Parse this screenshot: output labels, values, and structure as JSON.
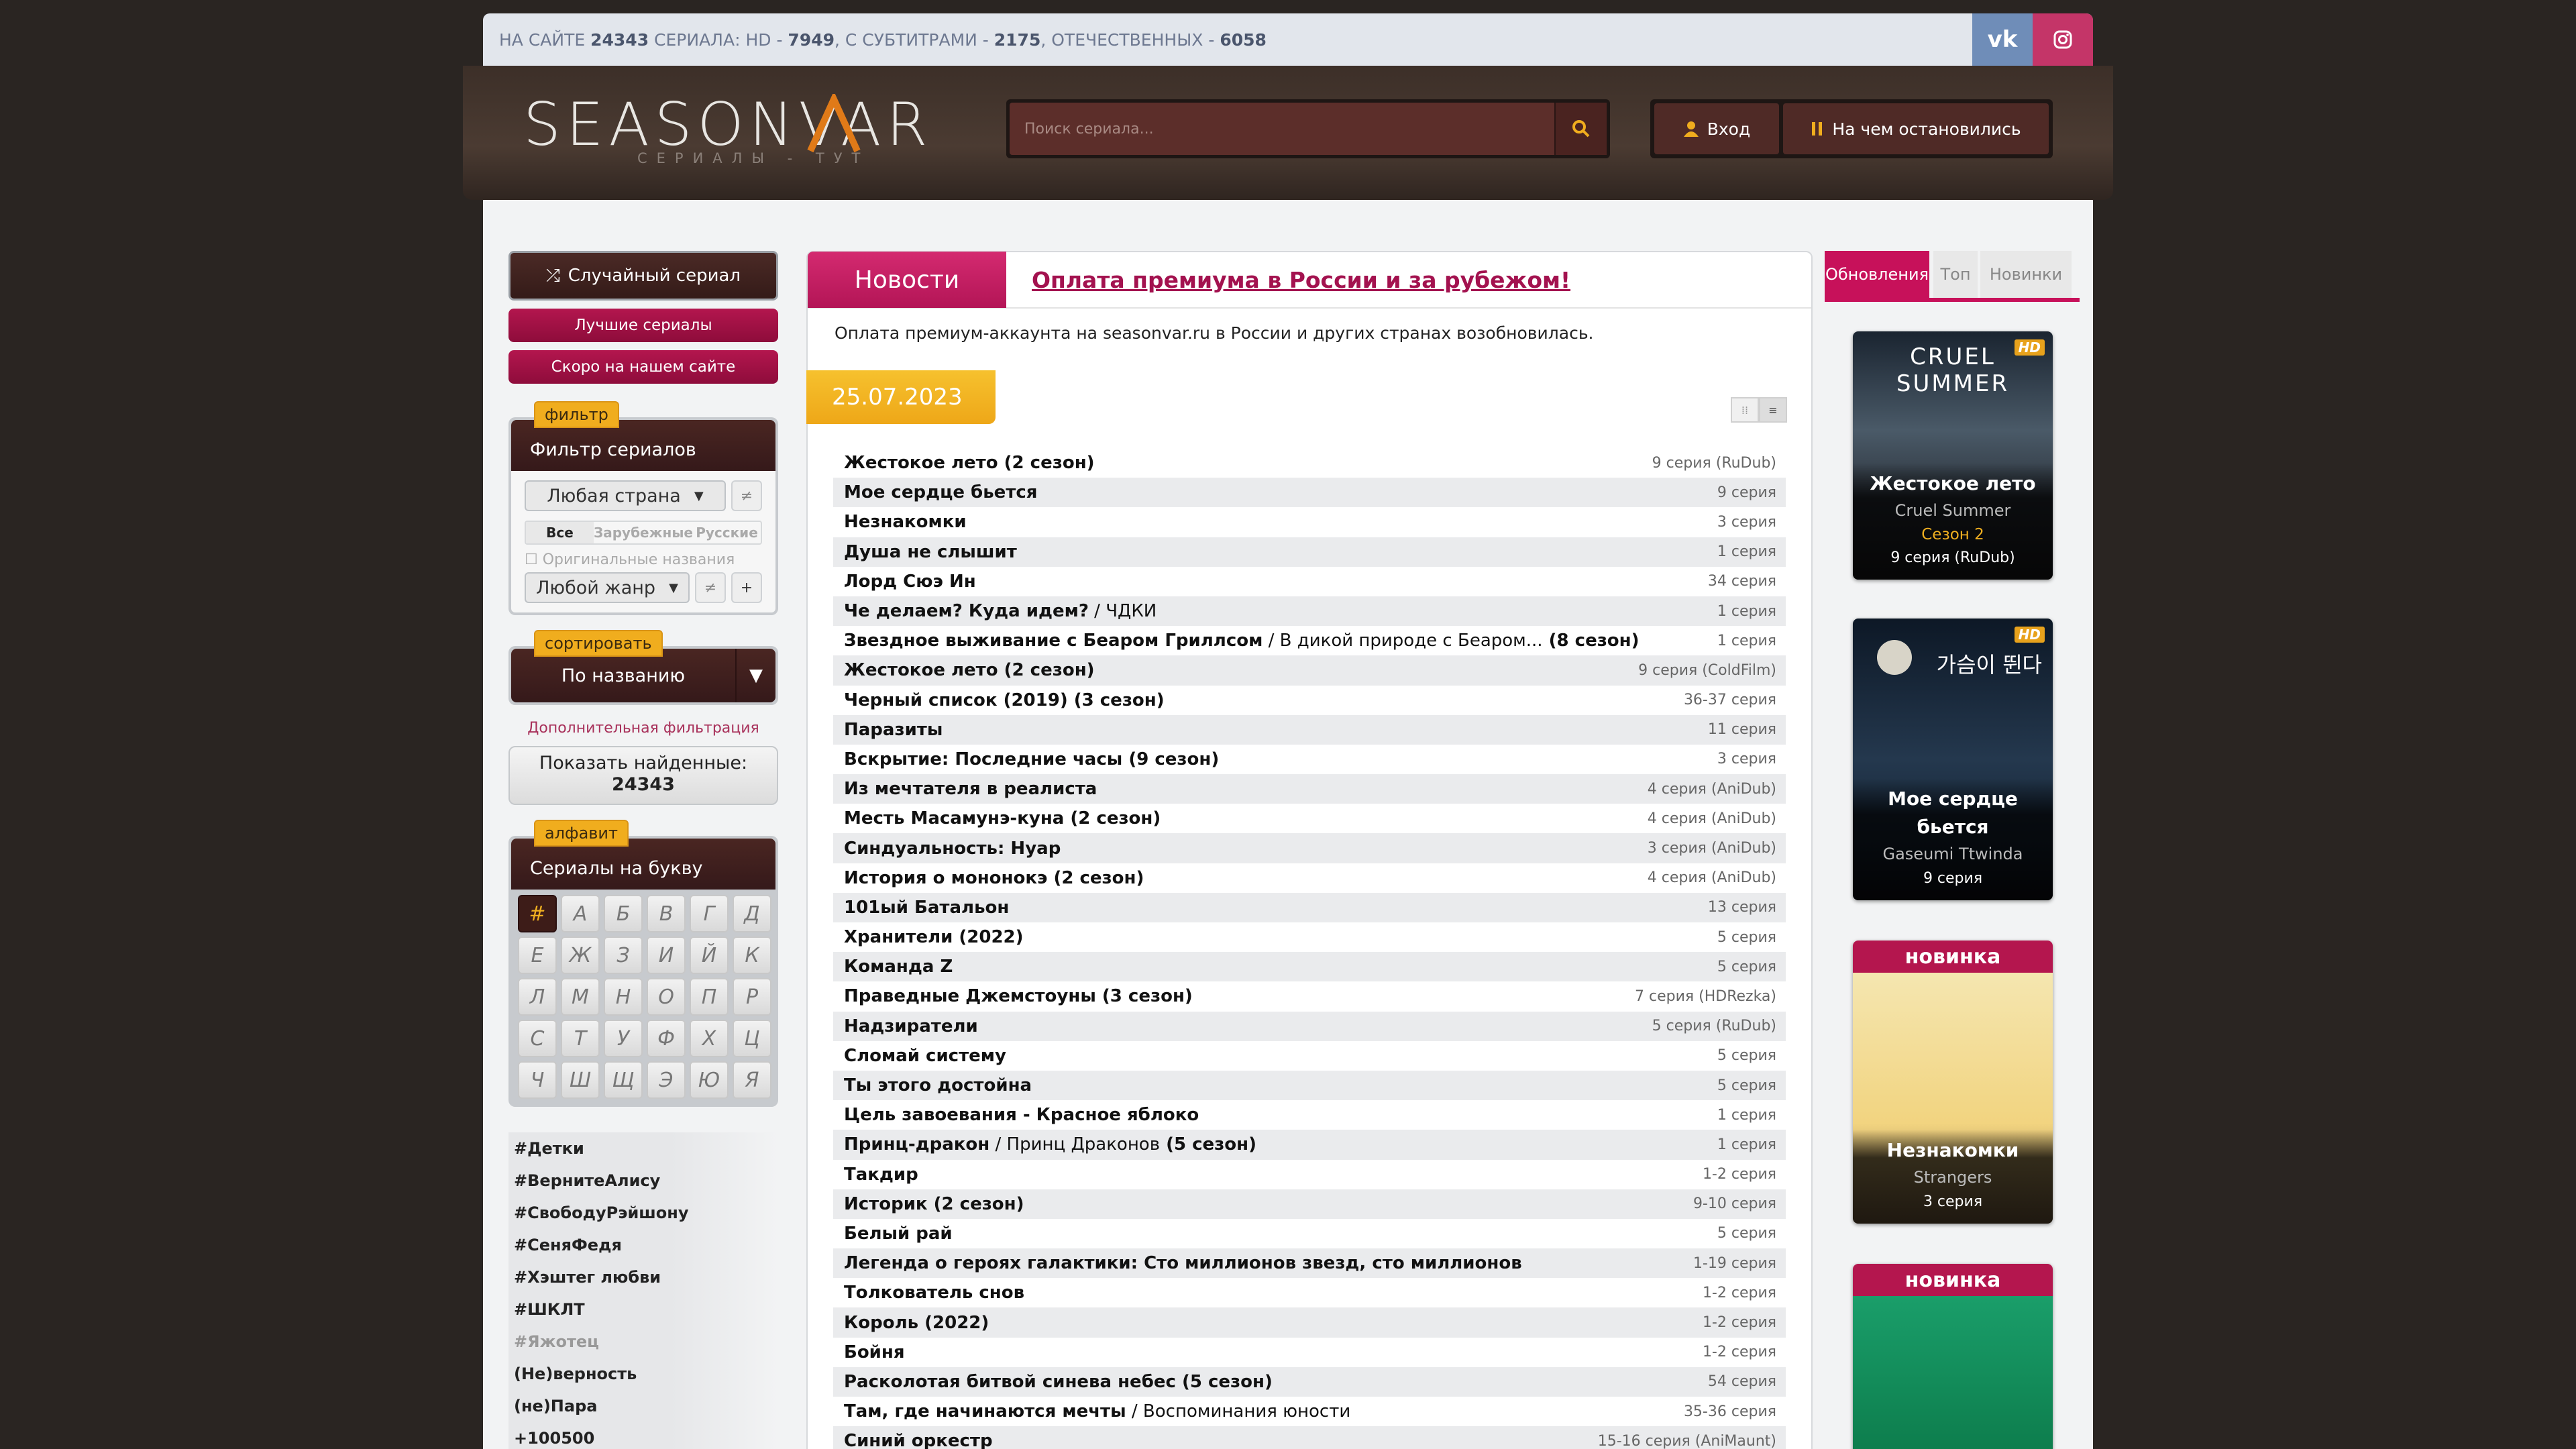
{
  "topbar": {
    "pre": "На сайте ",
    "total": "24343",
    "mid1": " сериала: HD - ",
    "hd": "7949",
    "mid2": ", с субтитрами - ",
    "subs": "2175",
    "mid3": ", отечественных - ",
    "domestic": "6058",
    "vk": "vk",
    "ig": "ig"
  },
  "header": {
    "logo": "SEASONVAR",
    "logo_sub": "СЕРИАЛЫ - ТУТ",
    "search_placeholder": "Поиск сериала...",
    "login": "Вход",
    "continue": "На чем остановились"
  },
  "left": {
    "random": "Случайный сериал",
    "best": "Лучшие сериалы",
    "soon": "Скоро на нашем сайте",
    "filter_tag": "фильтр",
    "filter_title": "Фильтр сериалов",
    "country": "Любая страна",
    "tab_all": "Все",
    "tab_foreign": "Зарубежные",
    "tab_russian": "Русские",
    "orig_names": "Оригинальные названия",
    "genre": "Любой жанр",
    "sort_tag": "сортировать",
    "sort_value": "По названию",
    "add_filter": "Дополнительная фильтрация",
    "show_found": "Показать найденные:",
    "found_count": "24343",
    "alpha_tag": "алфавит",
    "alpha_title": "Сериалы на букву",
    "letters": [
      "#",
      "А",
      "Б",
      "В",
      "Г",
      "Д",
      "Е",
      "Ж",
      "З",
      "И",
      "Й",
      "К",
      "Л",
      "М",
      "Н",
      "О",
      "П",
      "Р",
      "С",
      "Т",
      "У",
      "Ф",
      "Х",
      "Ц",
      "Ч",
      "Ш",
      "Щ",
      "Э",
      "Ю",
      "Я"
    ],
    "tags": [
      "#Детки",
      "#ВернитеАлису",
      "#СвободуРэйшону",
      "#СеняФедя",
      "#Хэштег любви",
      "#ШКЛТ",
      "#Яжотец",
      "(Не)верность",
      "(не)Пара",
      "+100500"
    ]
  },
  "news": {
    "tab": "Новости",
    "headline": "Оплата премиума в России и за рубежом!",
    "text": "Оплата премиум-аккаунта на seasonvar.ru в России и других странах возобновилась."
  },
  "date": "25.07.2023",
  "updates": [
    {
      "title": "Жестокое лето (2 сезон)",
      "ep": "9 серия (RuDub)"
    },
    {
      "title": "Мое сердце бьется",
      "ep": "9 серия"
    },
    {
      "title": "Незнакомки",
      "ep": "3 серия"
    },
    {
      "title": "Душа не слышит",
      "ep": "1 серия"
    },
    {
      "title": "Лорд Сюэ Ин",
      "ep": "34 серия"
    },
    {
      "title": "Че делаем? Куда идем?",
      "alt": " / ЧДКИ",
      "ep": "1 серия"
    },
    {
      "title": "Звездное выживание с Беаром Гриллсом",
      "alt": " / В дикой природе с Беаром...",
      "suffix": " (8 сезон)",
      "ep": "1 серия"
    },
    {
      "title": "Жестокое лето (2 сезон)",
      "ep": "9 серия (ColdFilm)"
    },
    {
      "title": "Черный список (2019) (3 сезон)",
      "ep": "36-37 серия"
    },
    {
      "title": "Паразиты",
      "ep": "11 серия"
    },
    {
      "title": "Вскрытие: Последние часы (9 сезон)",
      "ep": "3 серия"
    },
    {
      "title": "Из мечтателя в реалиста",
      "ep": "4 серия (AniDub)"
    },
    {
      "title": "Месть Масамунэ-куна (2 сезон)",
      "ep": "4 серия (AniDub)"
    },
    {
      "title": "Синдуальность: Нуар",
      "ep": "3 серия (AniDub)"
    },
    {
      "title": "История о мононокэ (2 сезон)",
      "ep": "4 серия (AniDub)"
    },
    {
      "title": "101ый Батальон",
      "ep": "13 серия"
    },
    {
      "title": "Хранители (2022)",
      "ep": "5 серия"
    },
    {
      "title": "Команда Z",
      "ep": "5 серия"
    },
    {
      "title": "Праведные Джемстоуны (3 сезон)",
      "ep": "7 серия (HDRezka)"
    },
    {
      "title": "Надзиратели",
      "ep": "5 серия (RuDub)"
    },
    {
      "title": "Сломай систему",
      "ep": "5 серия"
    },
    {
      "title": "Ты этого достойна",
      "ep": "5 серия"
    },
    {
      "title": "Цель завоевания - Красное яблоко",
      "ep": "1 серия"
    },
    {
      "title": "Принц-дракон",
      "alt": " / Принц Драконов",
      "suffix": " (5 сезон)",
      "ep": "1 серия"
    },
    {
      "title": "Такдир",
      "ep": "1-2 серия"
    },
    {
      "title": "Историк (2 сезон)",
      "ep": "9-10 серия"
    },
    {
      "title": "Белый рай",
      "ep": "5 серия"
    },
    {
      "title": "Легенда о героях галактики: Сто миллионов звезд, сто миллионов",
      "ep": "1-19 серия"
    },
    {
      "title": "Толкователь снов",
      "ep": "1-2 серия"
    },
    {
      "title": "Король (2022)",
      "ep": "1-2 серия"
    },
    {
      "title": "Бойня",
      "ep": "1-2 серия"
    },
    {
      "title": "Расколотая битвой синева небес (5 сезон)",
      "ep": "54 серия"
    },
    {
      "title": "Там, где начинаются мечты",
      "alt": " / Воспоминания юности",
      "ep": "35-36 серия"
    },
    {
      "title": "Синий оркестр",
      "ep": "15-16 серия (AniMaunt)"
    }
  ],
  "right": {
    "tabs": [
      "Обновления",
      "Топ",
      "Новинки"
    ],
    "cards": [
      {
        "badge": "HD",
        "name": "Жестокое лето",
        "orig": "Cruel Summer",
        "season": "Сезон 2",
        "ep": "9 серия (RuDub)",
        "poster_text": "CRUEL SUMMER"
      },
      {
        "badge": "HD",
        "name": "Мое сердце бьется",
        "orig": "Gaseumi Ttwinda",
        "ep": "9 серия",
        "poster_text": "가슴이 뛴다"
      },
      {
        "label": "новинка",
        "name": "Незнакомки",
        "orig": "Strangers",
        "ep": "3 серия"
      },
      {
        "label": "новинка"
      }
    ]
  },
  "colors": {
    "accent": "#c7115a",
    "gold": "#f0ad1e",
    "dark": "#3d1c18"
  }
}
